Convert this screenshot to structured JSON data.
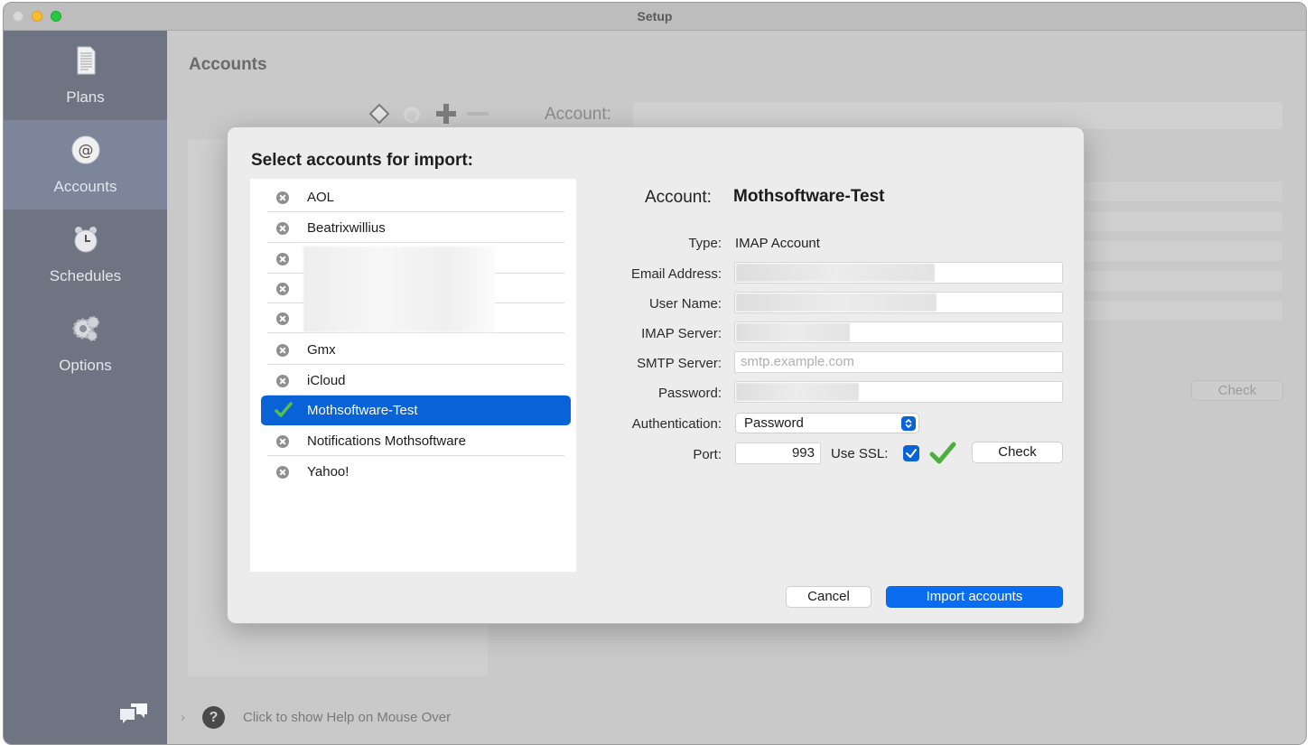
{
  "window": {
    "title": "Setup"
  },
  "sidebar": {
    "items": [
      {
        "label": "Plans",
        "icon": "document-icon"
      },
      {
        "label": "Accounts",
        "icon": "at-sign-icon"
      },
      {
        "label": "Schedules",
        "icon": "alarm-clock-icon"
      },
      {
        "label": "Options",
        "icon": "gears-icon"
      }
    ],
    "active": "Accounts"
  },
  "background": {
    "heading": "Accounts",
    "account_label": "Account:",
    "check_label": "Check"
  },
  "help": {
    "text": "Click to show Help on Mouse Over"
  },
  "modal": {
    "title": "Select accounts for import:",
    "accounts": [
      {
        "label": "AOL",
        "selected": false
      },
      {
        "label": "Beatrixwillius",
        "selected": false
      },
      {
        "label": "",
        "selected": false
      },
      {
        "label": "",
        "selected": false
      },
      {
        "label": "",
        "selected": false
      },
      {
        "label": "Gmx",
        "selected": false
      },
      {
        "label": "iCloud",
        "selected": false
      },
      {
        "label": "Mothsoftware-Test",
        "selected": true
      },
      {
        "label": "Notifications Mothsoftware",
        "selected": false
      },
      {
        "label": "Yahoo!",
        "selected": false
      }
    ],
    "detail": {
      "account_label": "Account:",
      "account_value": "Mothsoftware-Test",
      "type_label": "Type:",
      "type_value": "IMAP Account",
      "email_label": "Email Address:",
      "username_label": "User Name:",
      "imap_label": "IMAP Server:",
      "smtp_label": "SMTP Server:",
      "smtp_placeholder": "smtp.example.com",
      "password_label": "Password:",
      "auth_label": "Authentication:",
      "auth_value": "Password",
      "port_label": "Port:",
      "port_value": "993",
      "ssl_label": "Use SSL:",
      "ssl_checked": true,
      "check_label": "Check"
    },
    "buttons": {
      "cancel": "Cancel",
      "import": "Import accounts"
    }
  },
  "colors": {
    "accent": "#0a62d7",
    "sidebar": "#6e7482",
    "success": "#4caf3c"
  }
}
